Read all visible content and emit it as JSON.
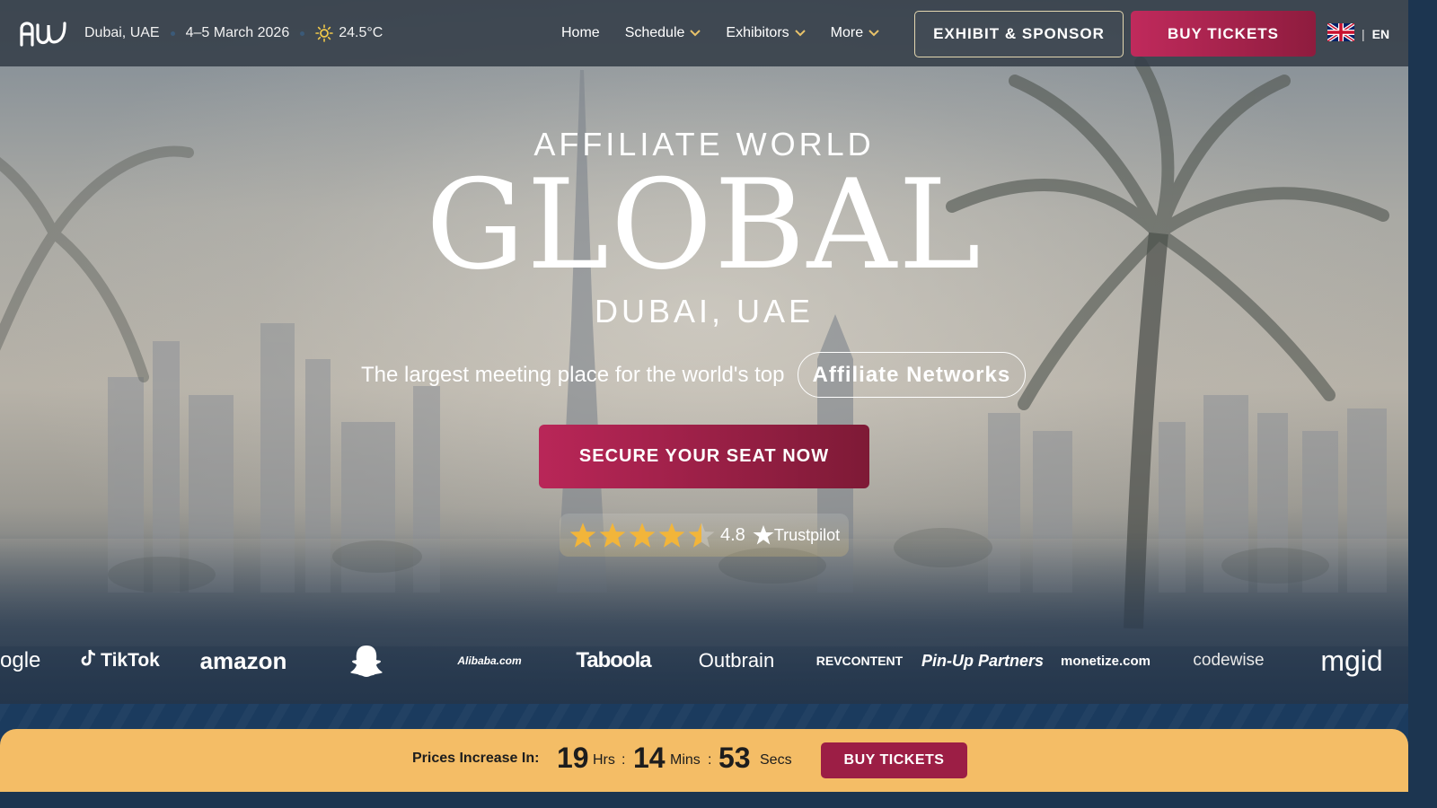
{
  "header": {
    "logo_icon": "afw-logo-icon",
    "location": "Dubai, UAE",
    "dates": "4–5 March 2026",
    "weather_icon": "sun-icon",
    "temperature": "24.5°C",
    "nav": [
      {
        "label": "Home",
        "has_dropdown": false
      },
      {
        "label": "Schedule",
        "has_dropdown": true
      },
      {
        "label": "Exhibitors",
        "has_dropdown": true
      },
      {
        "label": "More",
        "has_dropdown": true
      }
    ],
    "exhibit_label": "EXHIBIT & SPONSOR",
    "buy_label": "BUY TICKETS",
    "flag_icon": "uk-flag-icon",
    "language": "EN"
  },
  "hero": {
    "overline": "AFFILIATE WORLD",
    "title": "GLOBAL",
    "subtitle": "DUBAI, UAE",
    "tagline": "The largest meeting place for the world's top",
    "highlight": "Affiliate Networks",
    "cta_label": "SECURE YOUR SEAT NOW",
    "rating": {
      "stars": 4.5,
      "max": 5,
      "score": "4.8",
      "provider": "Trustpilot"
    }
  },
  "partners": [
    "ogle",
    "TikTok",
    "amazon",
    "Snapchat",
    "Alibaba.com",
    "Taboola",
    "Outbrain",
    "REVCONTENT",
    "Pin-Up Partners",
    "monetize.com",
    "codewise",
    "mgid"
  ],
  "countdown": {
    "label": "Prices Increase In:",
    "hours": "19",
    "hours_unit": "Hrs",
    "minutes": "14",
    "minutes_unit": "Mins",
    "seconds": "53",
    "seconds_unit": "Secs",
    "button_label": "BUY TICKETS"
  },
  "colors": {
    "accent": "#a8234f",
    "nav_bg": "#343e48",
    "countdown_bg": "#f4bd66",
    "band_bg": "#1b3b5e"
  }
}
